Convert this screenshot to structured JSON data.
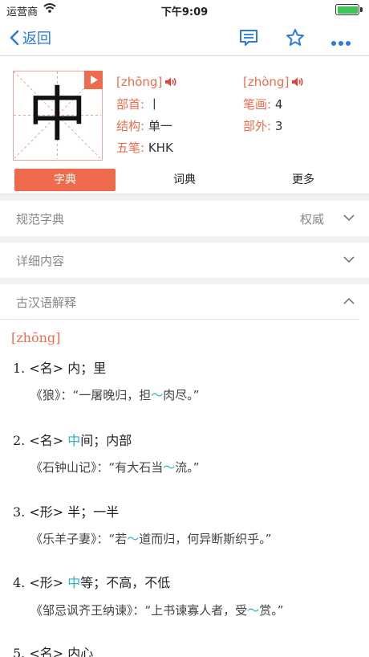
{
  "status": {
    "carrier": "运营商",
    "time": "下午9:09"
  },
  "nav": {
    "back_label": "返回"
  },
  "character": {
    "glyph": "中",
    "pinyin_left": "[zhōng]",
    "pinyin_right": "[zhòng]",
    "radical_label": "部首:",
    "radical_value": "丨",
    "strokes_label": "笔画:",
    "strokes_value": "4",
    "structure_label": "结构:",
    "structure_value": "单一",
    "outer_label": "部外:",
    "outer_value": "3",
    "wubi_label": "五笔:",
    "wubi_value": "KHK"
  },
  "tabs": [
    {
      "label": "字典",
      "active": true
    },
    {
      "label": "词典",
      "active": false
    },
    {
      "label": "更多",
      "active": false
    }
  ],
  "sections": {
    "standard": {
      "label": "规范字典",
      "right": "权威"
    },
    "detail": {
      "label": "详细内容"
    },
    "ancient": {
      "label": "古汉语解释"
    }
  },
  "ancient": {
    "pinyin": "[zhōng]",
    "entries": [
      {
        "num": "1.",
        "pos": "<名>",
        "pre": "",
        "hl": "",
        "post": "内；里",
        "ex_pre": "《狼》：“一屠晚归，担",
        "ex_hl": "～",
        "ex_post": "肉尽。”"
      },
      {
        "num": "2.",
        "pos": "<名>",
        "pre": "",
        "hl": "中",
        "post": "间；内部",
        "ex_pre": "《石钟山记》：“有大石当",
        "ex_hl": "～",
        "ex_post": "流。”"
      },
      {
        "num": "3.",
        "pos": "<形>",
        "pre": "",
        "hl": "",
        "post": "半；一半",
        "ex_pre": "《乐羊子妻》：“若",
        "ex_hl": "～",
        "ex_post": "道而归，何异断斯织乎。”"
      },
      {
        "num": "4.",
        "pos": "<形>",
        "pre": "",
        "hl": "中",
        "post": "等；不高，不低",
        "ex_pre": "《邹忌讽齐王纳谏》：“上书谏寡人者，受",
        "ex_hl": "～",
        "ex_post": "赏。”"
      },
      {
        "num": "5.",
        "pos": "<名>",
        "pre": "",
        "hl": "",
        "post": "内心"
      }
    ]
  },
  "colors": {
    "accent": "#ee6c4d",
    "link": "#2a7ae2",
    "highlight": "#2bb3c0"
  }
}
